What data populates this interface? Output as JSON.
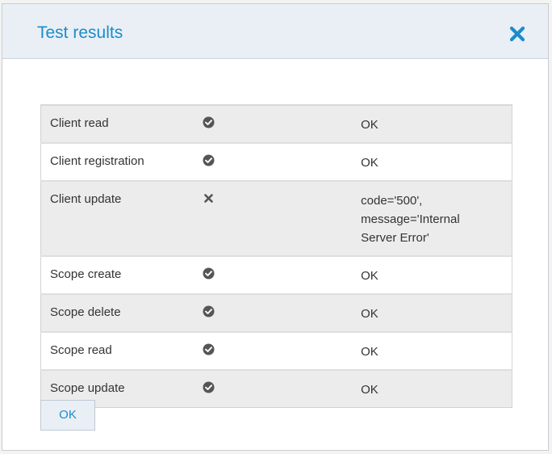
{
  "dialog": {
    "title": "Test results",
    "close_icon": "close-icon",
    "ok_label": "OK"
  },
  "colors": {
    "accent": "#1a8ccc",
    "header_bg": "#e9eff5",
    "row_shaded": "#ececec",
    "icon": "#555555"
  },
  "results": [
    {
      "name": "Client read",
      "status": "success",
      "status_icon": "check-circle-icon",
      "message": "OK"
    },
    {
      "name": "Client registration",
      "status": "success",
      "status_icon": "check-circle-icon",
      "message": "OK"
    },
    {
      "name": "Client update",
      "status": "failure",
      "status_icon": "x-icon",
      "message": "code='500', message='Internal Server Error'"
    },
    {
      "name": "Scope create",
      "status": "success",
      "status_icon": "check-circle-icon",
      "message": "OK"
    },
    {
      "name": "Scope delete",
      "status": "success",
      "status_icon": "check-circle-icon",
      "message": "OK"
    },
    {
      "name": "Scope read",
      "status": "success",
      "status_icon": "check-circle-icon",
      "message": "OK"
    },
    {
      "name": "Scope update",
      "status": "success",
      "status_icon": "check-circle-icon",
      "message": "OK"
    }
  ]
}
